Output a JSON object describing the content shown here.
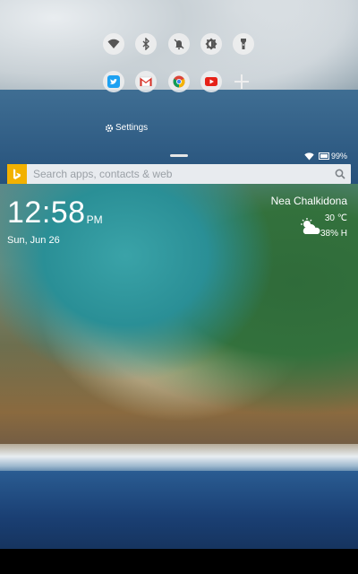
{
  "quick_settings": {
    "row1": [
      {
        "icon": "wifi-icon"
      },
      {
        "icon": "bluetooth-icon"
      },
      {
        "icon": "do-not-disturb-bell-icon"
      },
      {
        "icon": "auto-brightness-icon"
      },
      {
        "icon": "flashlight-icon"
      }
    ],
    "row2": [
      {
        "icon": "twitter-icon",
        "color": "#1da1f2"
      },
      {
        "icon": "gmail-icon",
        "color": "#d93025"
      },
      {
        "icon": "chrome-icon",
        "color": "#4285f4"
      },
      {
        "icon": "youtube-icon",
        "color": "#e62117"
      },
      {
        "icon": "add-icon"
      }
    ],
    "settings_label": "Settings"
  },
  "status_bar": {
    "battery_percent": "99%"
  },
  "search": {
    "placeholder": "Search apps, contacts & web",
    "brand_color": "#f2b100"
  },
  "clock": {
    "time": "12:58",
    "ampm": "PM",
    "date": "Sun, Jun 26"
  },
  "weather": {
    "city": "Nea Chalkidona",
    "temperature": "30 ℃",
    "humidity": "38% H"
  }
}
